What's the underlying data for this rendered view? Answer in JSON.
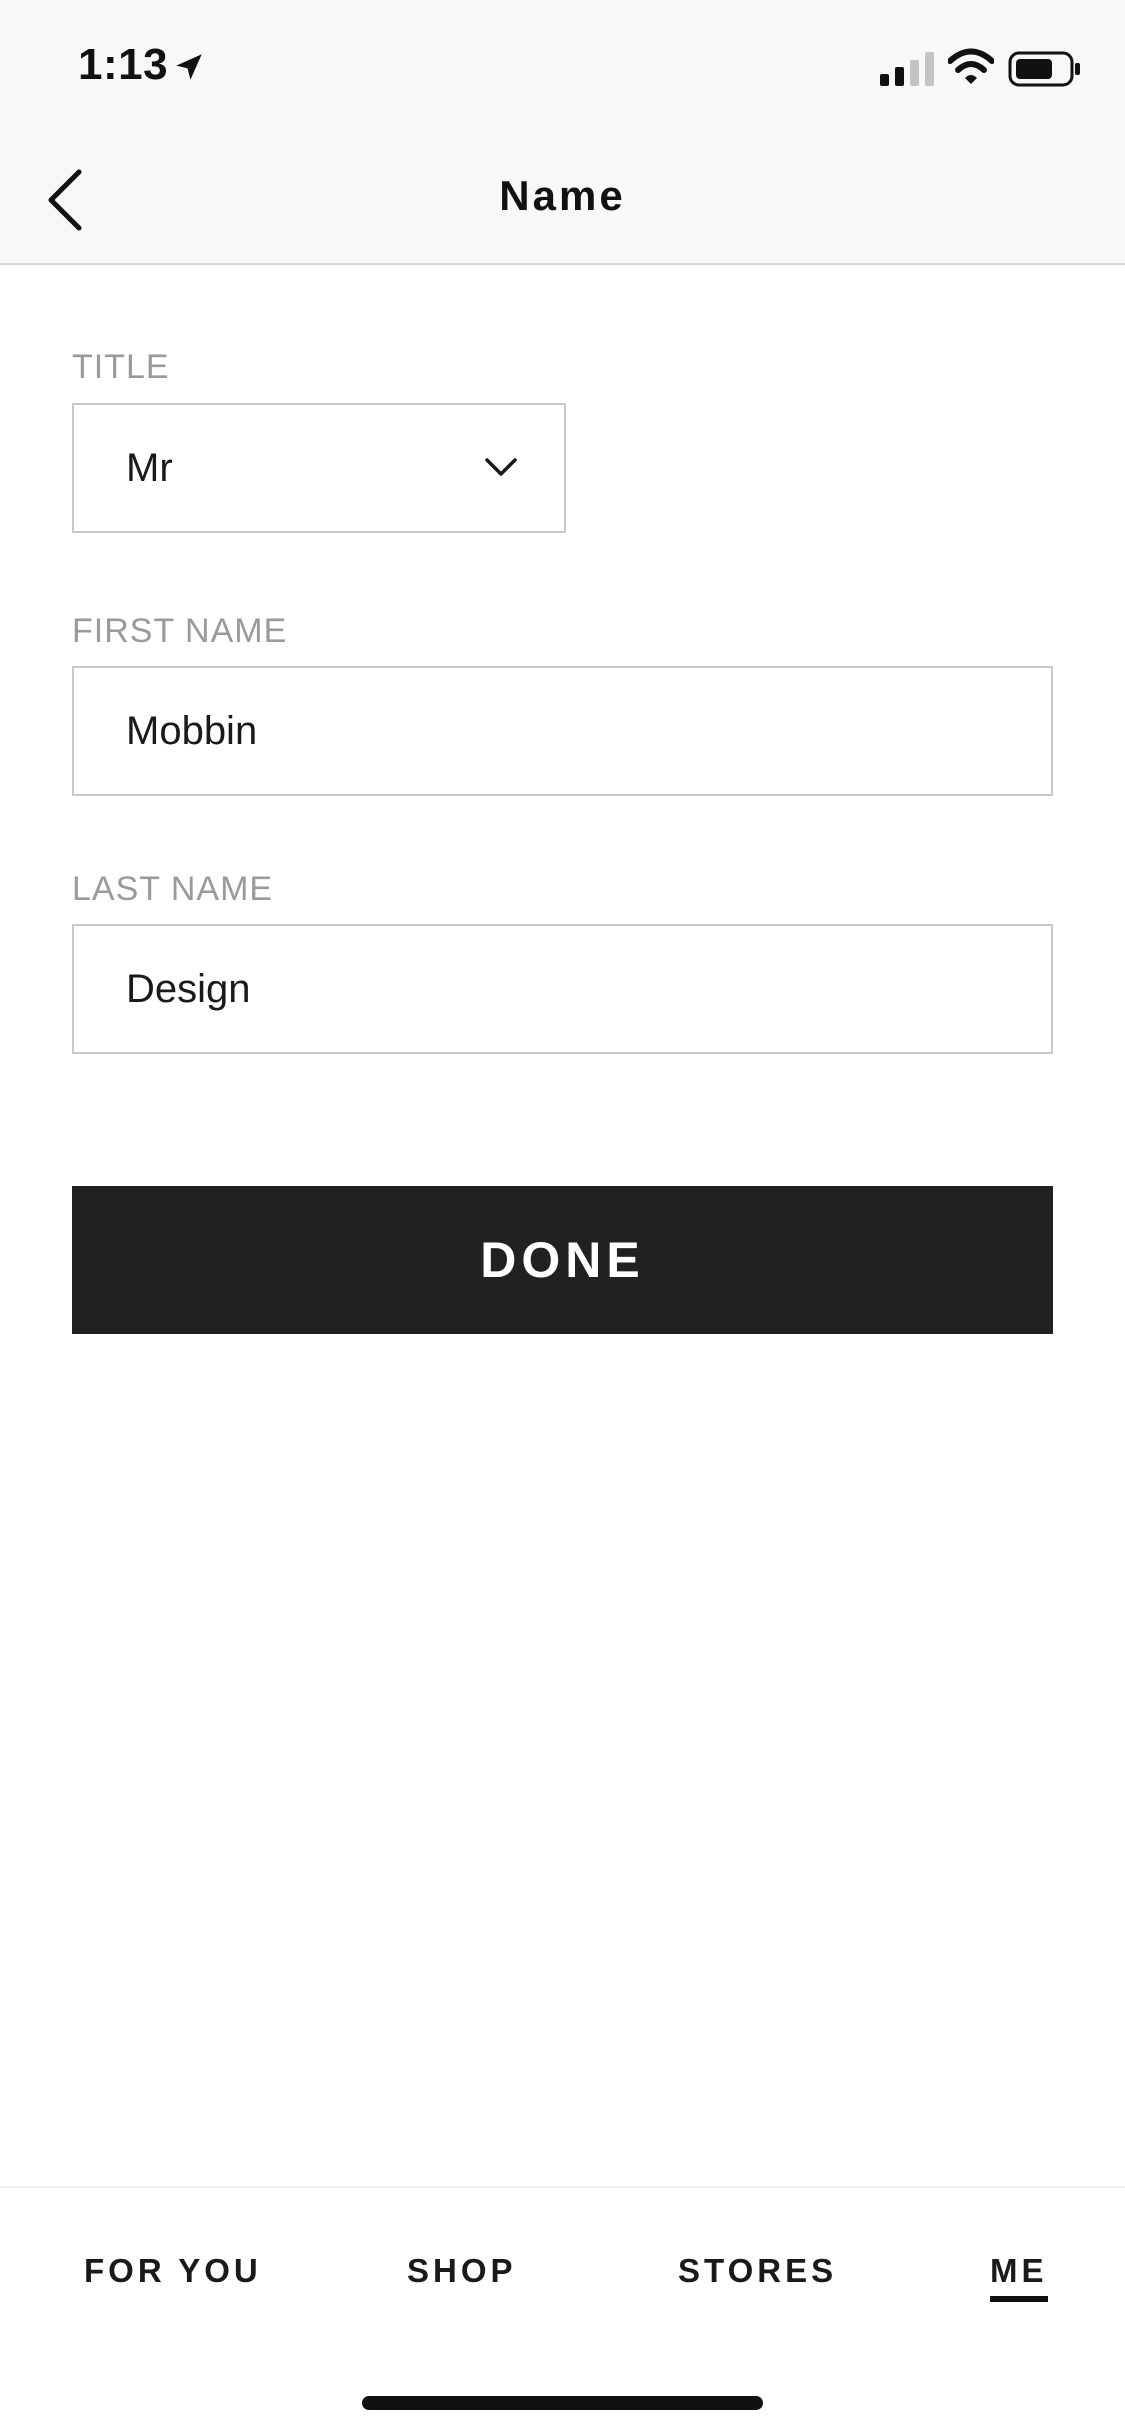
{
  "status_bar": {
    "time": "1:13",
    "icons": [
      "location-arrow-icon",
      "signal-icon",
      "wifi-icon",
      "battery-icon"
    ]
  },
  "header": {
    "title": "Name",
    "back_icon": "chevron-left-icon"
  },
  "form": {
    "title_label": "TITLE",
    "title_value": "Mr",
    "first_name_label": "FIRST NAME",
    "first_name_value": "Mobbin",
    "last_name_label": "LAST NAME",
    "last_name_value": "Design",
    "done_label": "DONE"
  },
  "tabs": [
    {
      "label": "FOR YOU",
      "active": false
    },
    {
      "label": "SHOP",
      "active": false
    },
    {
      "label": "STORES",
      "active": false
    },
    {
      "label": "ME",
      "active": true
    }
  ],
  "colors": {
    "header_bg": "#f8f8f8",
    "button_bg": "#212121",
    "label": "#9a9a9a",
    "border": "#c8c8c8"
  }
}
